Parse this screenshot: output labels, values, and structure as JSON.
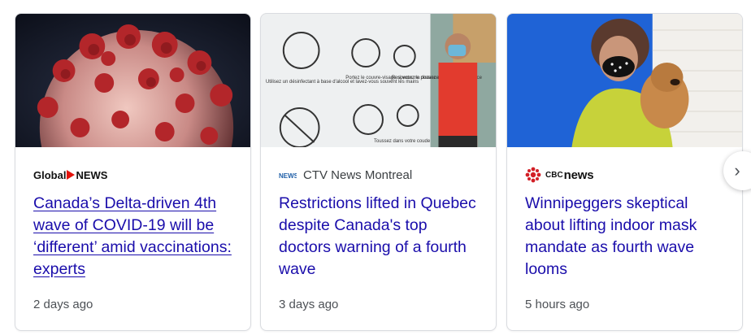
{
  "cards": [
    {
      "source": "Global NEWS",
      "source_parts": {
        "brand": "Global",
        "suffix": "NEWS"
      },
      "headline": "Canada’s Delta-driven 4th wave of COVID-19 will be ‘different’ amid vaccinations: experts",
      "time": "2 days ago"
    },
    {
      "source": "CTV News Montreal",
      "logo_text": "NEWS",
      "headline": "Restrictions lifted in Quebec despite Canada's top doctors warning of a fourth wave",
      "time": "3 days ago",
      "sign_texts": [
        "Utilisez un désinfectant à base d'alcool et lavez-vous souvent les mains",
        "Portez le couvre-visage si vous ne pouvez maintenir la distance",
        "Respectez la distance",
        "Toussez dans votre coude"
      ]
    },
    {
      "source": "cbcnews",
      "source_parts": {
        "prefix": "CBC",
        "suffix": "news"
      },
      "headline": "Winnipeggers skeptical about lifting indoor mask mandate as fourth wave looms",
      "time": "5 hours ago"
    }
  ],
  "next_button": {
    "icon": "chevron-right-icon",
    "glyph": "›"
  },
  "colors": {
    "headline": "#1a0dab",
    "global_red": "#e3120b",
    "cbc_red": "#d21f26",
    "ctv_blue": "#1f5fa8"
  }
}
